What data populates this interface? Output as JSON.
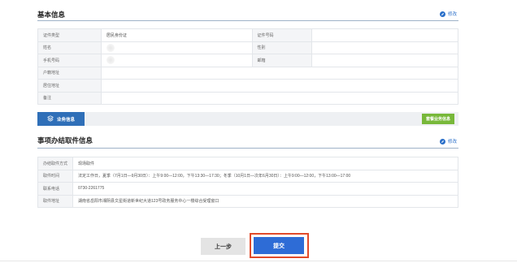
{
  "basic_info": {
    "title": "基本信息",
    "edit_label": "修改",
    "rows": [
      {
        "label": "证件类型",
        "value": "居民身份证",
        "label2": "证件号码",
        "value2": ""
      },
      {
        "label": "姓名",
        "value": "",
        "label2": "性别",
        "value2": ""
      },
      {
        "label": "手机号码",
        "value": "",
        "label2": "邮箱",
        "value2": ""
      },
      {
        "label": "户籍地址",
        "value": ""
      },
      {
        "label": "居住地址",
        "value": ""
      },
      {
        "label": "备注",
        "value": ""
      }
    ]
  },
  "business_bar": {
    "tab_label": "业务信息",
    "green_button_label": "套餐业务信息"
  },
  "pickup_info": {
    "title": "事项办结取件信息",
    "edit_label": "修改",
    "rows": [
      {
        "label": "办结取件方式",
        "value": "现场取件"
      },
      {
        "label": "取件时间",
        "value": "法定工作日，夏季（7月1日—9月30日）：上午9:00—12:00，下午13:30—17:30；冬季（10月1日—次年6月30日）：上午9:00—12:00，下午13:00—17:00"
      },
      {
        "label": "联系电话",
        "value": "0730-2261775"
      },
      {
        "label": "取件地址",
        "value": "湖南省岳阳市湘阴县文星街道新世纪大道123号政务服务中心一楼综合受理窗口"
      }
    ]
  },
  "actions": {
    "prev_label": "上一步",
    "submit_label": "提交"
  },
  "colors": {
    "primary": "#2f6fb8",
    "submit": "#2e6cd6",
    "highlight": "#e24a2a",
    "green": "#78b83a"
  }
}
